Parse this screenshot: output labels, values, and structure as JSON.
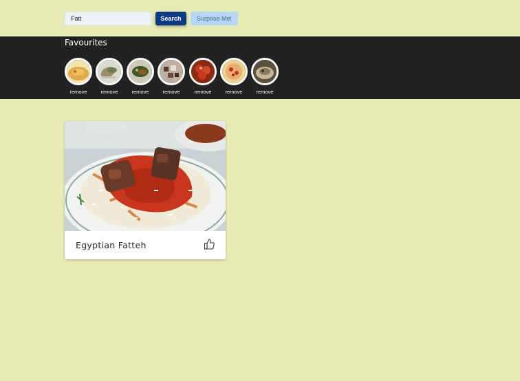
{
  "search": {
    "value": "Fatt",
    "button_label": "Search",
    "surprise_label": "Surprise Me!"
  },
  "favourites": {
    "title": "Favourites",
    "items": [
      {
        "remove_label": "remove",
        "colors": [
          "#e0a94a",
          "#f3e3b0",
          "#b86a1f"
        ]
      },
      {
        "remove_label": "remove",
        "colors": [
          "#d8ddd0",
          "#9a8f6a",
          "#6d7d4a"
        ]
      },
      {
        "remove_label": "remove",
        "colors": [
          "#cfc9b8",
          "#3e5a2b",
          "#8a5a2a"
        ]
      },
      {
        "remove_label": "remove",
        "colors": [
          "#bcb0a2",
          "#5a3a2a",
          "#e6e0d4"
        ]
      },
      {
        "remove_label": "remove",
        "colors": [
          "#c9381e",
          "#8a2a12",
          "#e8a070"
        ]
      },
      {
        "remove_label": "remove",
        "colors": [
          "#e8b070",
          "#c8301e",
          "#f0d090"
        ]
      },
      {
        "remove_label": "remove",
        "colors": [
          "#5a5040",
          "#c8b898",
          "#8a7858"
        ]
      }
    ]
  },
  "results": [
    {
      "title": "Egyptian Fatteh",
      "like_icon": "thumbs-up-icon"
    }
  ],
  "colors": {
    "page_bg": "#e6eab4",
    "fav_bar_bg": "#222222",
    "search_button": "#0e3a84",
    "surprise_button": "#b8d5f4"
  }
}
